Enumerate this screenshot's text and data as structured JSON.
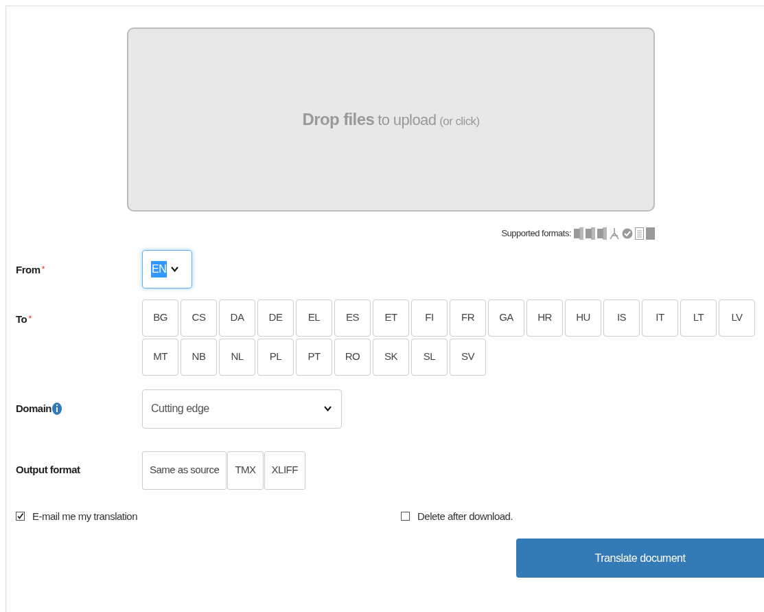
{
  "drop_zone": {
    "title": "Drop files",
    "subtitle": "to upload",
    "hint": "(or click)"
  },
  "supported_formats": {
    "label": "Supported formats:"
  },
  "from": {
    "label": "From",
    "required": "*",
    "value": "EN"
  },
  "to": {
    "label": "To",
    "required": "*",
    "languages": [
      {
        "code": "BG",
        "selected": false
      },
      {
        "code": "CS",
        "selected": false
      },
      {
        "code": "DA",
        "selected": false
      },
      {
        "code": "DE",
        "selected": false
      },
      {
        "code": "EL",
        "selected": false
      },
      {
        "code": "ES",
        "selected": false
      },
      {
        "code": "ET",
        "selected": false
      },
      {
        "code": "FI",
        "selected": false
      },
      {
        "code": "FR",
        "selected": false
      },
      {
        "code": "GA",
        "selected": false
      },
      {
        "code": "HR",
        "selected": false
      },
      {
        "code": "HU",
        "selected": false
      },
      {
        "code": "IS",
        "selected": false
      },
      {
        "code": "IT",
        "selected": false
      },
      {
        "code": "LT",
        "selected": false
      },
      {
        "code": "LV",
        "selected": false
      },
      {
        "code": "MT",
        "selected": false
      },
      {
        "code": "NB",
        "selected": false
      },
      {
        "code": "NL",
        "selected": false
      },
      {
        "code": "PL",
        "selected": false
      },
      {
        "code": "PT",
        "selected": false
      },
      {
        "code": "RO",
        "selected": false
      },
      {
        "code": "SK",
        "selected": false
      },
      {
        "code": "SL",
        "selected": false
      },
      {
        "code": "SV",
        "selected": false
      }
    ]
  },
  "domain": {
    "label": "Domain",
    "value": "Cutting edge"
  },
  "output_format": {
    "label": "Output format",
    "options": [
      {
        "label": "Same as source",
        "selected": false
      },
      {
        "label": "TMX",
        "selected": false
      },
      {
        "label": "XLIFF",
        "selected": false
      }
    ]
  },
  "options": [
    {
      "label": "E-mail me my translation",
      "checked": true
    },
    {
      "label": "Delete after download.",
      "checked": false
    }
  ],
  "submit": {
    "label": "Translate document"
  }
}
